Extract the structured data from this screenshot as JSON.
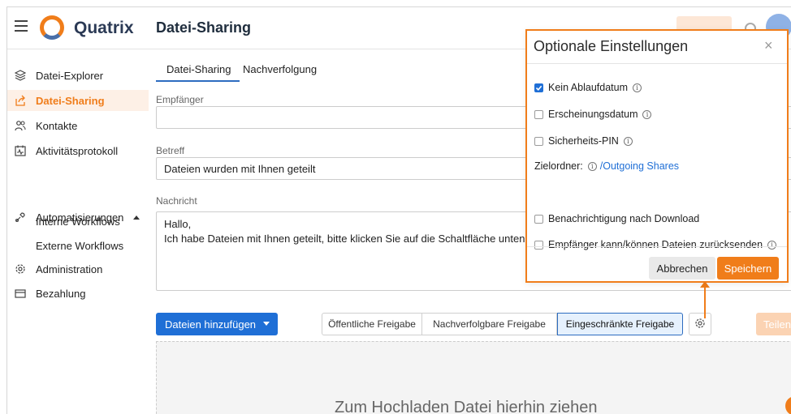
{
  "header": {
    "logo_text": "Quatrix",
    "page_title": "Datei-Sharing"
  },
  "sidebar": {
    "items": [
      {
        "label": "Datei-Explorer",
        "icon": "layers-icon"
      },
      {
        "label": "Datei-Sharing",
        "icon": "share-icon",
        "active": true
      },
      {
        "label": "Kontakte",
        "icon": "contacts-icon"
      },
      {
        "label": "Aktivitätsprotokoll",
        "icon": "activity-log-icon"
      },
      {
        "label": "Automatisierungen",
        "icon": "automation-icon"
      },
      {
        "label": "Interne Workflows"
      },
      {
        "label": "Externe Workflows"
      },
      {
        "label": "Administration",
        "icon": "gear-admin-icon"
      },
      {
        "label": "Bezahlung",
        "icon": "card-icon"
      }
    ]
  },
  "tabs": [
    "Datei-Sharing",
    "Nachverfolgung"
  ],
  "form": {
    "recipient_label": "Empfänger",
    "recipient_value": "",
    "subject_label": "Betreff",
    "subject_value": "Dateien wurden mit Ihnen geteilt",
    "message_label": "Nachricht",
    "message_line1": "Hallo,",
    "message_line2": "Ich habe Dateien mit Ihnen geteilt, bitte klicken Sie auf die Schaltfläche unten, um"
  },
  "toolbar": {
    "add_files": "Dateien hinzufügen",
    "share_types": [
      "Öffentliche Freigabe",
      "Nachverfolgbare Freigabe",
      "Eingeschränkte Freigabe"
    ],
    "selected_share_type": "Eingeschränkte Freigabe",
    "share_button": "Teilen"
  },
  "dropzone": {
    "text": "Zum Hochladen Datei hierhin ziehen"
  },
  "popup": {
    "title": "Optionale Einstellungen",
    "close": "×",
    "options": [
      {
        "label": "Kein Ablaufdatum",
        "checked": true,
        "info": true
      },
      {
        "label": "Erscheinungsdatum",
        "checked": false,
        "info": true
      },
      {
        "label": "Sicherheits-PIN",
        "checked": false,
        "info": true
      }
    ],
    "target_folder_label": "Zielordner:",
    "target_folder_value": "/Outgoing Shares",
    "options2": [
      {
        "label": "Benachrichtigung nach Download",
        "checked": false,
        "info": false
      },
      {
        "label": "Empfänger kann/können Dateien zurücksenden",
        "checked": false,
        "info": true
      }
    ],
    "cancel": "Abbrechen",
    "save": "Speichern"
  },
  "colors": {
    "accent": "#f07d1a",
    "primary": "#1f6fd6"
  }
}
